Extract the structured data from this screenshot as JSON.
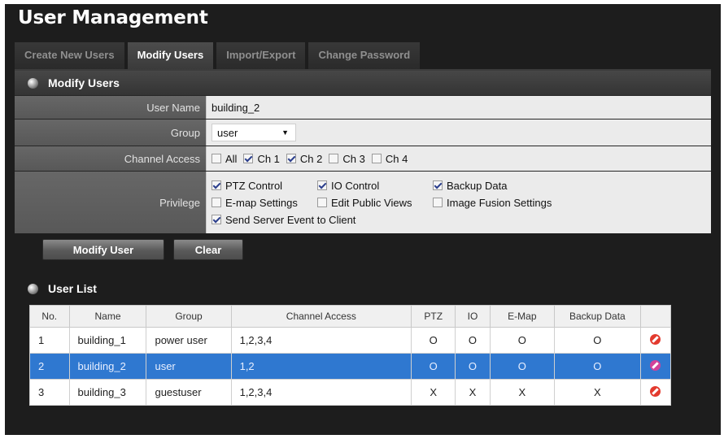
{
  "title": "User Management",
  "tabs": [
    {
      "label": "Create New Users"
    },
    {
      "label": "Modify Users"
    },
    {
      "label": "Import/Export"
    },
    {
      "label": "Change Password"
    }
  ],
  "modify": {
    "header": "Modify Users",
    "username_label": "User Name",
    "username_value": "building_2",
    "group_label": "Group",
    "group_value": "user",
    "channel_label": "Channel Access",
    "channels": [
      {
        "label": "All",
        "checked": false
      },
      {
        "label": "Ch 1",
        "checked": true
      },
      {
        "label": "Ch 2",
        "checked": true
      },
      {
        "label": "Ch 3",
        "checked": false
      },
      {
        "label": "Ch 4",
        "checked": false
      }
    ],
    "privilege_label": "Privilege",
    "privileges": [
      {
        "label": "PTZ Control",
        "checked": true
      },
      {
        "label": "IO Control",
        "checked": true
      },
      {
        "label": "Backup Data",
        "checked": true
      },
      {
        "label": "E-map Settings",
        "checked": false
      },
      {
        "label": "Edit Public Views",
        "checked": false
      },
      {
        "label": "Image Fusion Settings",
        "checked": false
      },
      {
        "label": "Send Server Event to Client",
        "checked": true
      }
    ],
    "modify_button": "Modify User",
    "clear_button": "Clear"
  },
  "user_list": {
    "header": "User List",
    "columns": [
      "No.",
      "Name",
      "Group",
      "Channel Access",
      "PTZ",
      "IO",
      "E-Map",
      "Backup Data"
    ],
    "rows": [
      {
        "no": "1",
        "name": "building_1",
        "group": "power user",
        "channels": "1,2,3,4",
        "ptz": "O",
        "io": "O",
        "emap": "O",
        "backup": "O"
      },
      {
        "no": "2",
        "name": "building_2",
        "group": "user",
        "channels": "1,2",
        "ptz": "O",
        "io": "O",
        "emap": "O",
        "backup": "O"
      },
      {
        "no": "3",
        "name": "building_3",
        "group": "guestuser",
        "channels": "1,2,3,4",
        "ptz": "X",
        "io": "X",
        "emap": "X",
        "backup": "X"
      }
    ]
  }
}
